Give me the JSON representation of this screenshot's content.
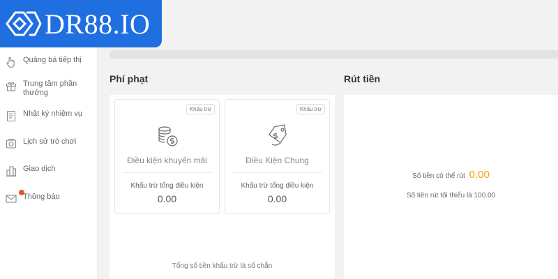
{
  "brand": {
    "name": "DR88.IO",
    "color": "#1f6fe0"
  },
  "sidebar": {
    "items": [
      {
        "label": "Quảng bá tiếp thị",
        "icon": "hand-pointer-icon"
      },
      {
        "label": "Trung tâm phần thưởng",
        "icon": "gift-icon"
      },
      {
        "label": "Nhật ký nhiệm vụ",
        "icon": "clipboard-list-icon"
      },
      {
        "label": "Lịch sử trò chơi",
        "icon": "game-history-icon"
      },
      {
        "label": "Giao dịch",
        "icon": "transactions-icon"
      },
      {
        "label": "Thông báo",
        "icon": "envelope-icon",
        "has_badge": true
      }
    ]
  },
  "penalty": {
    "title": "Phí phạt",
    "cards": [
      {
        "tag": "Khấu trừ",
        "icon": "coins-dollar-icon",
        "title": "Điều kiện khuyến mãi",
        "sub": "Khấu trừ tổng điều kiện",
        "value": "0.00"
      },
      {
        "tag": "Khấu trừ",
        "icon": "price-tag-icon",
        "title": "Điều Kiện Chung",
        "sub": "Khấu trừ tổng điều kiện",
        "value": "0.00"
      }
    ],
    "footer": "Tổng số tiền khấu trừ là số chẵn"
  },
  "withdraw": {
    "title": "Rút tiền",
    "available_label": "Số tiền có thể rút",
    "available_value": "0.00",
    "min_text": "Số tiền rút tối thiểu là 100.00"
  },
  "colors": {
    "accent_amount": "#f0a20a",
    "badge": "#f0541e"
  }
}
